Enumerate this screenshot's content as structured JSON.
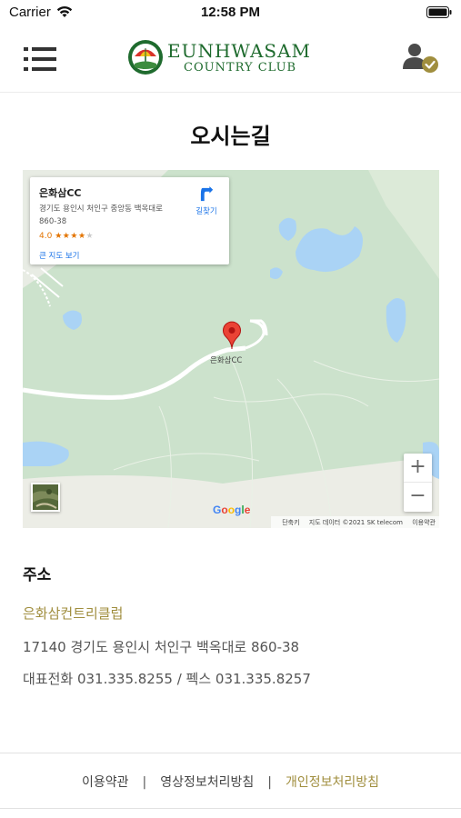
{
  "status_bar": {
    "carrier": "Carrier",
    "time": "12:58 PM"
  },
  "header": {
    "logo_name": "EUNHWASAM",
    "logo_sub": "COUNTRY CLUB"
  },
  "page": {
    "title": "오시는길"
  },
  "map": {
    "place_name": "은화삼CC",
    "place_address": "경기도 용인시 처인구 중앙동 백옥대로 860-38",
    "rating": "4.0",
    "rating_stars": 4,
    "rating_max": 5,
    "larger_map_link": "큰 지도 보기",
    "directions_label": "길찾기",
    "pin_label": "은화삼CC",
    "zoom_in": "+",
    "zoom_out": "−",
    "google_logo": "Google",
    "footer": {
      "shortcuts": "단축키",
      "map_data": "지도 데이터 ©2021 SK telecom",
      "terms": "이용약관"
    }
  },
  "address": {
    "heading": "주소",
    "club_name": "은화삼컨트리클럽",
    "address_line": "17140 경기도 용인시 처인구 백옥대로 860-38",
    "phone_line": "대표전화 031.335.8255 / 펙스 031.335.8257"
  },
  "footer": {
    "links": [
      {
        "label": "이용약관"
      },
      {
        "label": "영상정보처리방침"
      },
      {
        "label": "개인정보처리방침"
      }
    ],
    "separator": "|"
  },
  "colors": {
    "accent_gold": "#a08e3e",
    "brand_green": "#1f6b2e",
    "map_green": "#cfe3cf",
    "map_water": "#aad3f5",
    "pin_red": "#ea4335"
  }
}
